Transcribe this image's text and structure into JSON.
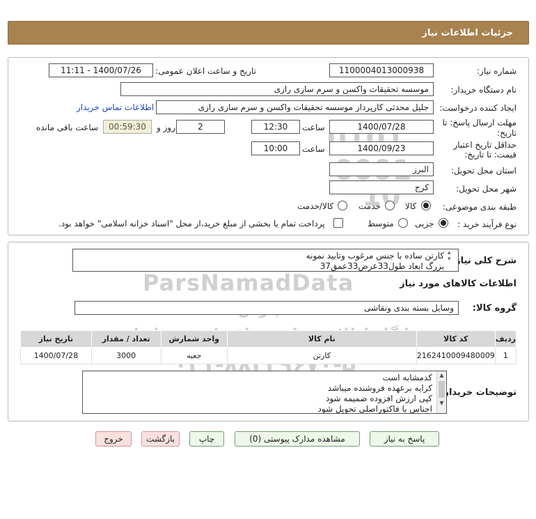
{
  "header": {
    "title": "جزئیات اطلاعات نیاز"
  },
  "details": {
    "need_number_label": "شماره نیاز:",
    "need_number": "1100004013000938",
    "announce_label": "تاریخ و ساعت اعلان عمومی:",
    "announce_value": "1400/07/26 - 11:11",
    "buyer_org_label": "نام دستگاه خریدار:",
    "buyer_org": "موسسه تحقیقات واکسن و سرم سازی رازی",
    "creator_label": "ایجاد کننده درخواست:",
    "creator": "جلیل محدثی کارپرداز موسسه تحقیقات واکسن و سرم سازی رازی",
    "contact_link": "اطلاعات تماس خریدار",
    "deadline_label_1": "مهلت ارسال پاسخ: تا",
    "deadline_label_2": "تاریخ:",
    "deadline_date": "1400/07/28",
    "time_label": "ساعت",
    "deadline_time": "12:30",
    "days_value": "2",
    "days_label": "روز و",
    "remaining_time": "00:59:30",
    "remaining_label": "ساعت باقی مانده",
    "price_label_1": "حداقل تاریخ اعتبار",
    "price_label_2": "قیمت: تا تاریخ:",
    "price_date": "1400/09/23",
    "price_time_label": "ساعت",
    "price_time": "10:00",
    "province_label": "استان محل تحویل:",
    "province": "البرز",
    "city_label": "شهر محل تحویل:",
    "city": "کرج",
    "category_label": "طبقه بندی موضوعی:",
    "category_options": [
      "کالا",
      "خدمت",
      "کالا/خدمت"
    ],
    "process_label": "نوع فرآیند خرید :",
    "process_options": [
      "جزیی",
      "متوسط"
    ],
    "payment_note": "پرداخت تمام یا بخشی از مبلغ خرید،از محل \"اسناد خزانه اسلامی\" خواهد بود."
  },
  "description": {
    "label": "شرح کلی نیاز:",
    "lines": [
      "کارتن ساده با جنس مرغوب وتایید نمونه",
      "بزرگ ابعاد طول33عرض33عمق37"
    ]
  },
  "goods": {
    "section_title": "اطلاعات کالاهای مورد نیاز",
    "group_label": "گروه کالا:",
    "group_value": "وسایل بسته بندی  ونقاشی",
    "columns": [
      "ردیف",
      "کد کالا",
      "نام کالا",
      "واحد شمارش",
      "تعداد / مقدار",
      "تاریخ نیاز"
    ],
    "rows": [
      [
        "1",
        "2162410009480009",
        "کارتن",
        "جعبه",
        "3000",
        "1400/07/28"
      ]
    ]
  },
  "buyer_notes": {
    "label": "توضیحات خریدار:",
    "lines": [
      "کدمشابه است",
      "کرایه برعهده فروشنده میباشد",
      "کپی ارزش افزوده ضمیمه شود",
      "اجناس با فاکتوراصلی تحویل شود"
    ]
  },
  "buttons": {
    "reply": "پاسخ به نیاز",
    "view_docs": "مشاهده مدارک پیوستی (0)",
    "print": "چاپ",
    "back": "بازگشت",
    "exit": "خروج"
  },
  "watermark": {
    "brand": "ParsNamadData",
    "line1": "پارس نماد داده ها",
    "line2": "پایگاه اطلاع رسانی مناقصات و مزایدات",
    "phone": "۰۲۱-۸۸۳۴۹۶۷۰-۵",
    "code_lines": [
      "0101",
      "0001",
      "10"
    ]
  },
  "colors": {
    "title_bar": "#a8824f",
    "link": "#1a44b8",
    "button_green": "#eef7e9",
    "button_pink": "#fbe0e0",
    "timer_bg": "#f2f0d4"
  }
}
